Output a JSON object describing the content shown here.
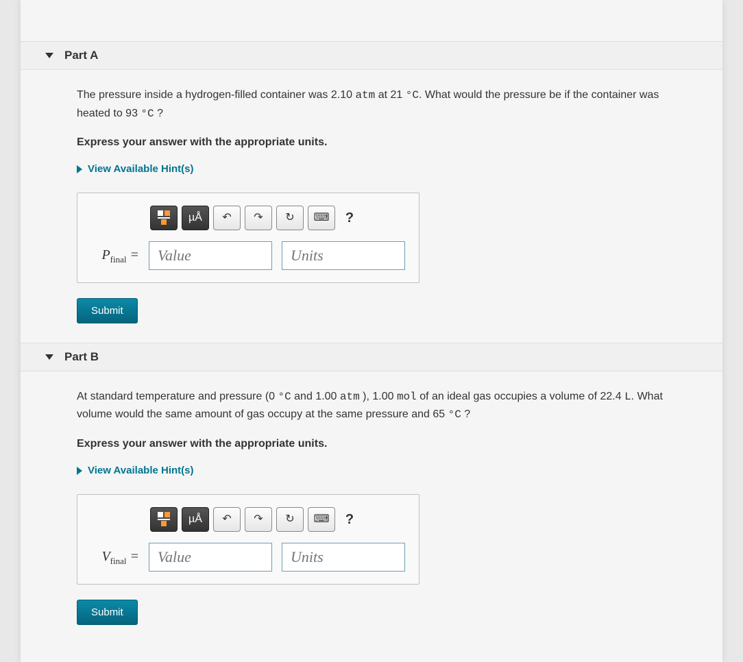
{
  "partA": {
    "title": "Part A",
    "question_before": "The pressure inside a hydrogen-filled container was 2.10 ",
    "q_unit1": "atm",
    "q_mid1": " at 21 ",
    "q_unit2": "°C",
    "q_mid2": ". What would the pressure be if the container was heated to 93 ",
    "q_unit3": "°C",
    "q_end": " ?",
    "instruction": "Express your answer with the appropriate units.",
    "hints_label": "View Available Hint(s)",
    "var_symbol": "P",
    "var_sub": "final",
    "equals": " = ",
    "value_placeholder": "Value",
    "units_placeholder": "Units",
    "submit": "Submit",
    "toolbar": {
      "units_btn": "µÅ",
      "help": "?"
    }
  },
  "partB": {
    "title": "Part B",
    "question_before": "At standard temperature and pressure (0 ",
    "q_unit1": "°C",
    "q_mid1": " and 1.00 ",
    "q_unit2": "atm",
    "q_mid2": " ), 1.00 ",
    "q_unit3": "mol",
    "q_mid3": " of an ideal gas occupies a volume of 22.4 ",
    "q_unit4": "L",
    "q_mid4": ". What volume would the same amount of gas occupy at the same pressure and 65 ",
    "q_unit5": "°C",
    "q_end": " ?",
    "instruction": "Express your answer with the appropriate units.",
    "hints_label": "View Available Hint(s)",
    "var_symbol": "V",
    "var_sub": "final",
    "equals": " = ",
    "value_placeholder": "Value",
    "units_placeholder": "Units",
    "submit": "Submit",
    "toolbar": {
      "units_btn": "µÅ",
      "help": "?"
    }
  }
}
